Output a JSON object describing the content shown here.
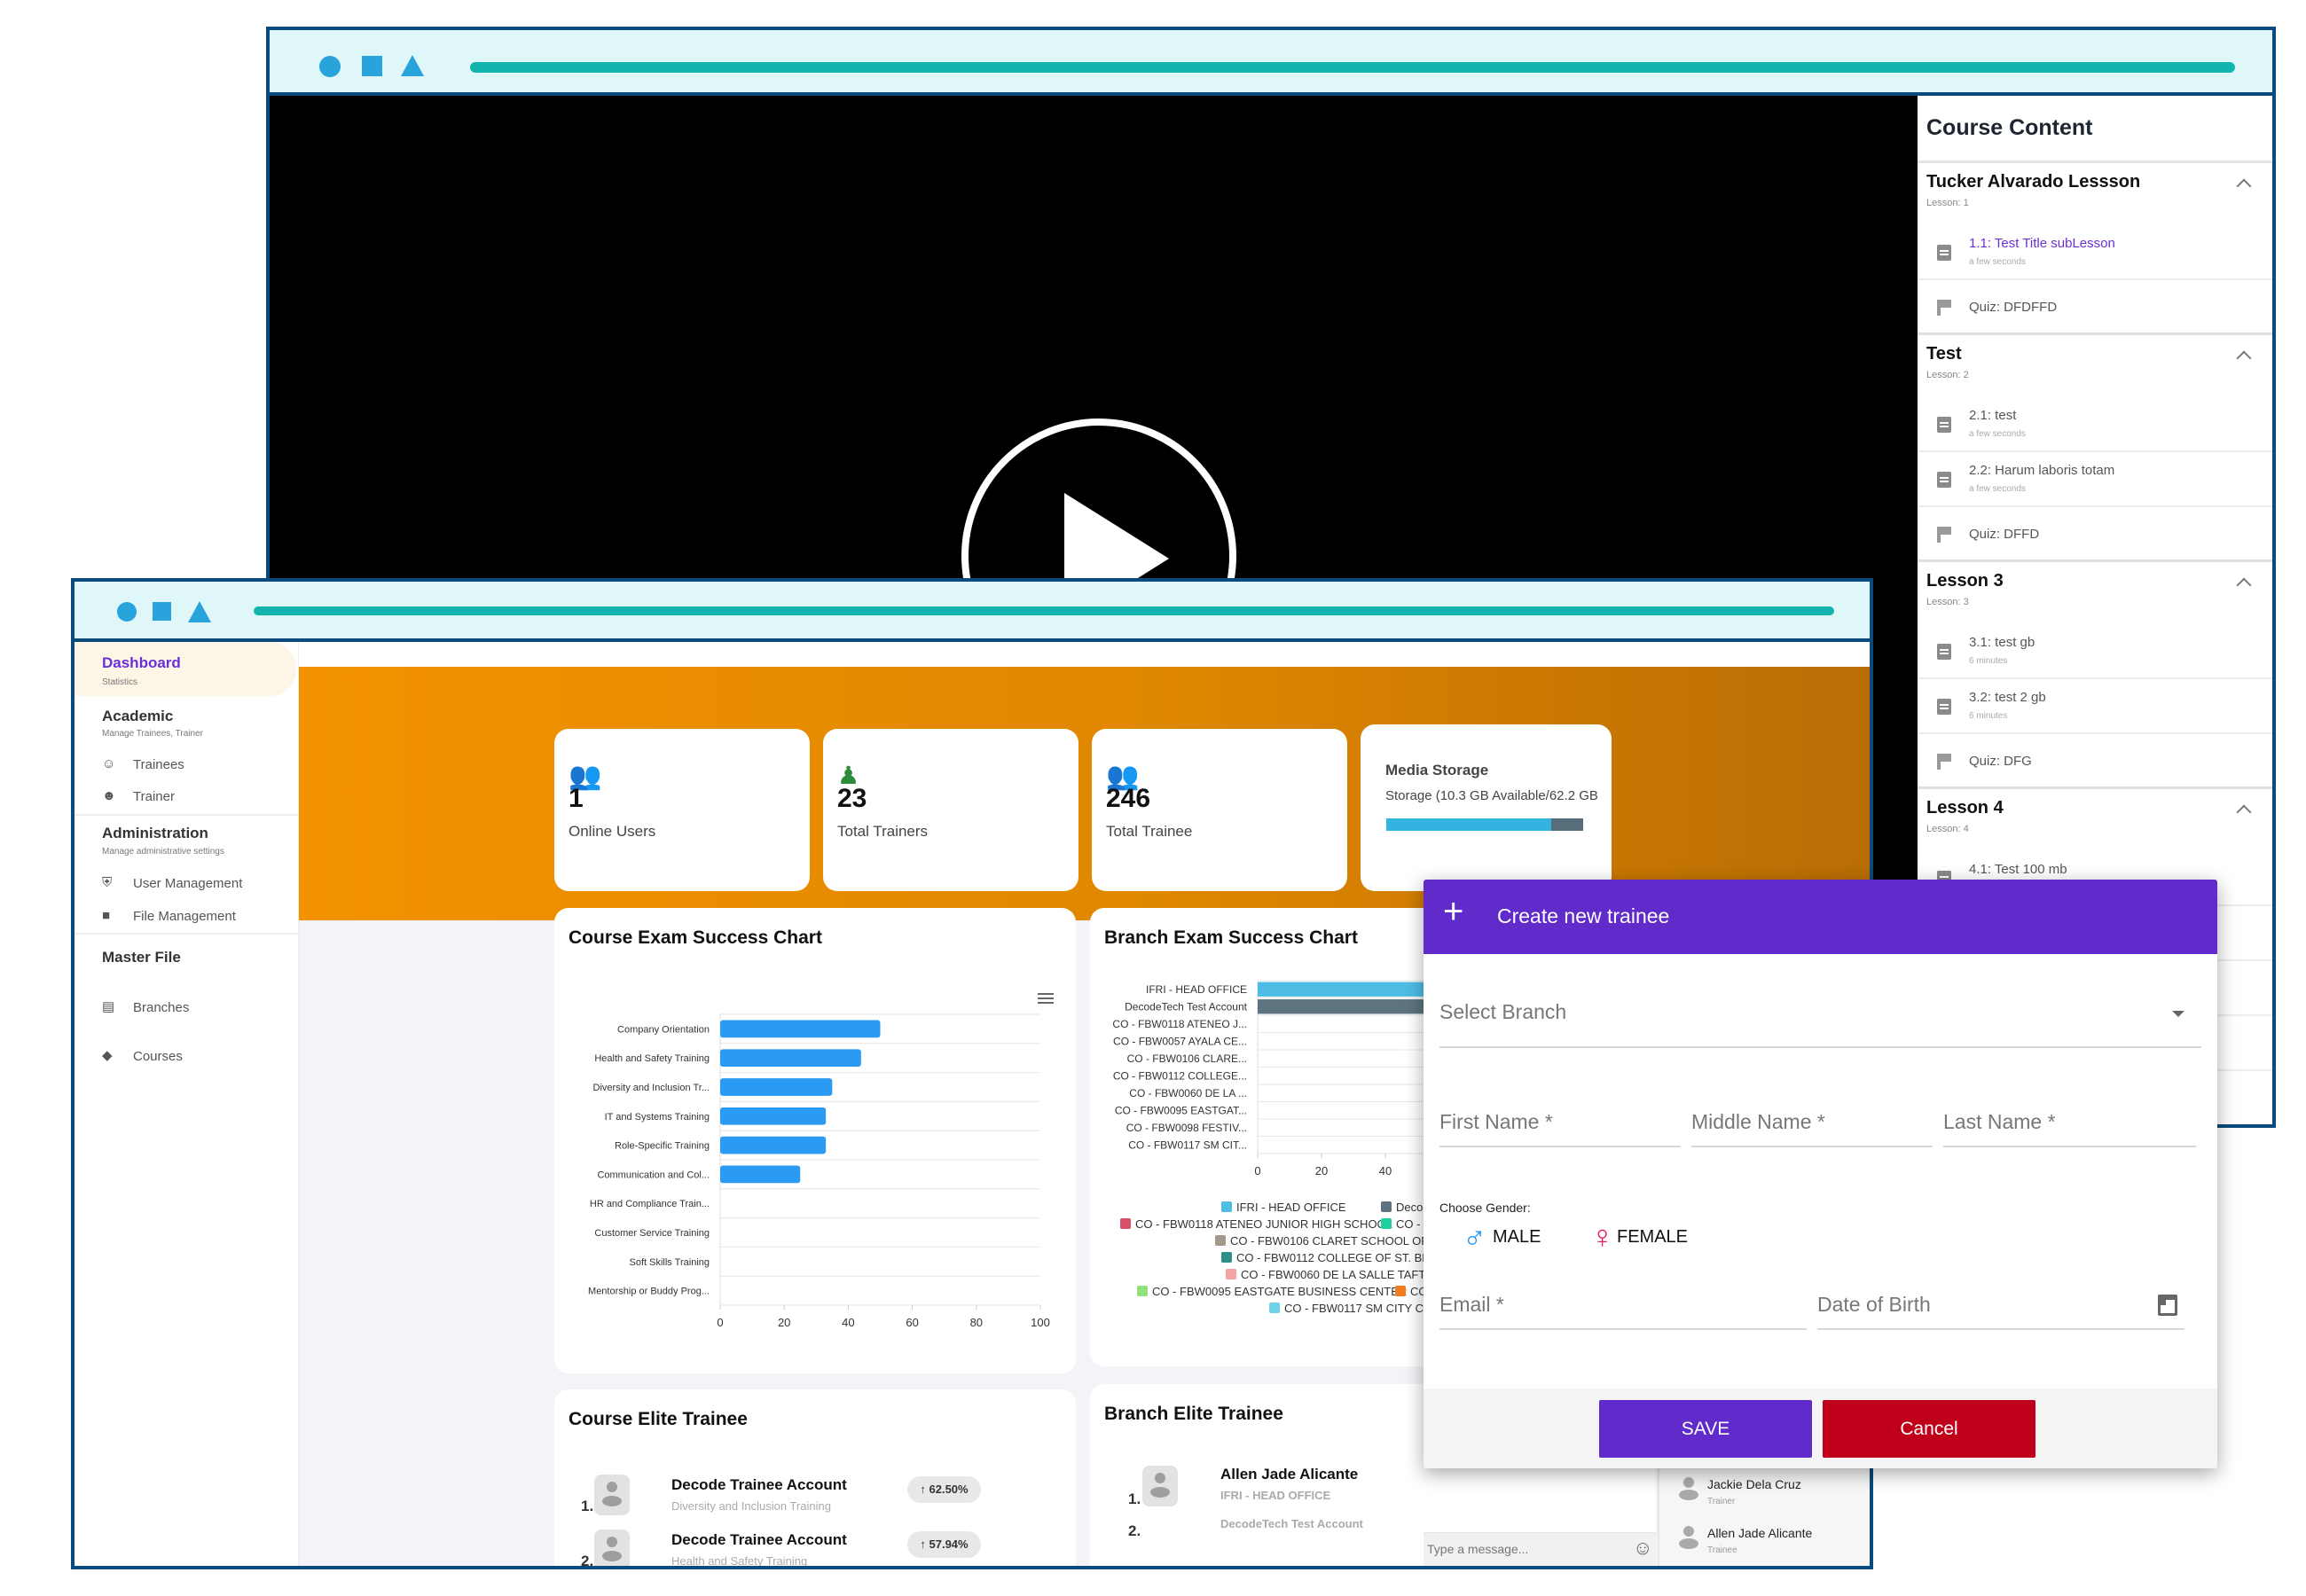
{
  "colors": {
    "window_border": "#0b4a7a",
    "titlebar": "#e0f7fa",
    "titlebar_icon": "#29a3dc",
    "titlebar_line": "#14b4ae",
    "accent": "#612bcc",
    "cancel": "#c0001a",
    "orange": "#f29200",
    "bar_blue": "#2b9af3"
  },
  "course_content": {
    "title": "Course Content",
    "lessons": [
      {
        "title": "Tucker Alvarado Lessson",
        "label": "Lesson: 1",
        "items": [
          {
            "type": "sublesson",
            "title": "1.1: Test Title subLesson",
            "meta": "a few seconds",
            "active": true
          },
          {
            "type": "quiz",
            "title": "Quiz: DFDFFD"
          }
        ]
      },
      {
        "title": "Test",
        "label": "Lesson: 2",
        "items": [
          {
            "type": "sublesson",
            "title": "2.1: test",
            "meta": "a few seconds"
          },
          {
            "type": "sublesson",
            "title": "2.2: Harum laboris totam",
            "meta": "a few seconds"
          },
          {
            "type": "quiz",
            "title": "Quiz: DFFD"
          }
        ]
      },
      {
        "title": "Lesson 3",
        "label": "Lesson: 3",
        "items": [
          {
            "type": "sublesson",
            "title": "3.1: test gb",
            "meta": "6 minutes"
          },
          {
            "type": "sublesson",
            "title": "3.2: test 2 gb",
            "meta": "6 minutes"
          },
          {
            "type": "quiz",
            "title": "Quiz: DFG"
          }
        ]
      },
      {
        "title": "Lesson 4",
        "label": "Lesson: 4",
        "items": [
          {
            "type": "sublesson",
            "title": "4.1: Test 100 mb",
            "meta": ""
          }
        ]
      }
    ]
  },
  "sidebar": {
    "dashboard": {
      "title": "Dashboard",
      "sub": "Statistics"
    },
    "academic": {
      "title": "Academic",
      "sub": "Manage Trainees, Trainer",
      "items": [
        {
          "label": "Trainees",
          "icon": "face-icon"
        },
        {
          "label": "Trainer",
          "icon": "trainer-face-icon"
        }
      ]
    },
    "administration": {
      "title": "Administration",
      "sub": "Manage administrative settings",
      "items": [
        {
          "label": "User Management",
          "icon": "shield-user-icon"
        },
        {
          "label": "File Management",
          "icon": "folder-icon"
        }
      ]
    },
    "master": {
      "title": "Master File",
      "items": [
        {
          "label": "Branches",
          "icon": "document-icon"
        },
        {
          "label": "Courses",
          "icon": "graduation-cap-icon"
        }
      ]
    }
  },
  "stats": [
    {
      "value": "1",
      "label": "Online Users",
      "icon": "users-icon",
      "color": "#1e6fd6"
    },
    {
      "value": "23",
      "label": "Total Trainers",
      "icon": "trainer-icon",
      "color": "#2e8b3a"
    },
    {
      "value": "246",
      "label": "Total Trainee",
      "icon": "trainees-icon",
      "color": "#f2b51c"
    }
  ],
  "storage": {
    "title": "Media Storage",
    "text": "Storage (10.3 GB Available/62.2 GB",
    "used_fraction": 0.84
  },
  "chart_data": [
    {
      "type": "bar",
      "orientation": "horizontal",
      "title": "Course Exam Success Chart",
      "categories": [
        "Company Orientation",
        "Health and Safety Training",
        "Diversity and Inclusion Tr...",
        "IT and Systems Training",
        "Role-Specific Training",
        "Communication and Col...",
        "HR and Compliance Train...",
        "Customer Service Training",
        "Soft Skills Training",
        "Mentorship or Buddy Prog..."
      ],
      "values": [
        50,
        44,
        35,
        33,
        33,
        25,
        0,
        0,
        0,
        0
      ],
      "xlim": [
        0,
        100
      ],
      "xticks": [
        0,
        20,
        40,
        60,
        80,
        100
      ],
      "grid": true,
      "color": "#2b9af3"
    },
    {
      "type": "bar",
      "orientation": "horizontal",
      "title": "Branch Exam Success Chart",
      "categories": [
        "IFRI - HEAD OFFICE",
        "DecodeTech Test Account",
        "CO - FBW0118 ATENEO J...",
        "CO - FBW0057 AYALA CE...",
        "CO - FBW0106 CLARE...",
        "CO - FBW0112 COLLEGE...",
        "CO - FBW0060 DE LA ...",
        "CO - FBW0095 EASTGAT...",
        "CO - FBW0098 FESTIV...",
        "CO - FBW0117 SM CIT..."
      ],
      "values": [
        60,
        60,
        0,
        0,
        0,
        0,
        0,
        0,
        0,
        0
      ],
      "colors": [
        "#4dbde6",
        "#5d7480"
      ],
      "xticks": [
        0,
        20,
        40
      ],
      "grid": true,
      "legend_placement": "bottom",
      "legend": [
        {
          "label": "IFRI - HEAD OFFICE",
          "color": "#4dbde6"
        },
        {
          "label": "DecodeTech",
          "color": "#5d7480"
        },
        {
          "label": "CO - FBW0118 ATENEO JUNIOR HIGH SCHOOL",
          "color": "#d9506a"
        },
        {
          "label": "CO -",
          "color": "#1fd0a0"
        },
        {
          "label": "CO - FBW0106 CLARET SCHOOL OF C",
          "color": "#a39a8e"
        },
        {
          "label": "CO - FBW0112 COLLEGE OF ST. BEN",
          "color": "#2e8f88"
        },
        {
          "label": "CO - FBW0060 DE LA SALLE TAFT U",
          "color": "#f4a2a2"
        },
        {
          "label": "CO - FBW0095 EASTGATE BUSINESS CENTER",
          "color": "#8fe37a"
        },
        {
          "label": "CO",
          "color": "#ef7d22"
        },
        {
          "label": "CO - FBW0117 SM CITY CE",
          "color": "#6fd3e8"
        }
      ]
    }
  ],
  "course_elite": {
    "title": "Course Elite Trainee",
    "rows": [
      {
        "rank": "1.",
        "name": "Decode Trainee Account",
        "course": "Diversity and Inclusion Training",
        "score": "↑ 62.50%"
      },
      {
        "rank": "2.",
        "name": "Decode Trainee Account",
        "course": "Health and Safety Training",
        "score": "↑ 57.94%"
      }
    ]
  },
  "branch_elite": {
    "title": "Branch Elite Trainee",
    "rows": [
      {
        "rank": "1.",
        "name": "Allen Jade Alicante",
        "branch": "IFRI - HEAD OFFICE"
      },
      {
        "rank": "2.",
        "name": "",
        "branch": "DecodeTech Test Account"
      }
    ]
  },
  "chat": {
    "placeholder": "Type a message...",
    "contacts": [
      {
        "name": "Jackie Dela Cruz",
        "role": "Trainer"
      },
      {
        "name": "Allen Jade Alicante",
        "role": "Trainee"
      }
    ]
  },
  "modal": {
    "title": "Create new trainee",
    "branch_placeholder": "Select Branch",
    "first_name": "First Name *",
    "middle_name": "Middle Name *",
    "last_name": "Last Name *",
    "gender_label": "Choose Gender:",
    "male": "MALE",
    "female": "FEMALE",
    "email": "Email *",
    "dob": "Date of Birth",
    "save": "SAVE",
    "cancel": "Cancel"
  }
}
